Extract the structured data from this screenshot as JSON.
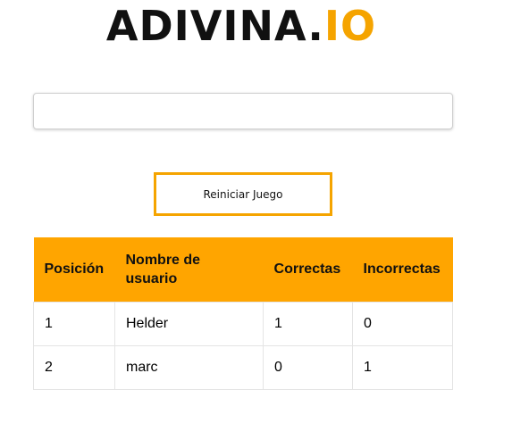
{
  "logo": {
    "main": "ADIVINA.",
    "accent": "IO"
  },
  "input": {
    "value": "",
    "placeholder": ""
  },
  "reset_button": {
    "label": "Reiniciar Juego"
  },
  "table": {
    "headers": [
      "Posición",
      "Nombre de usuario",
      "Correctas",
      "Incorrectas"
    ],
    "rows": [
      [
        "1",
        "Helder",
        "1",
        "0"
      ],
      [
        "2",
        "marc",
        "0",
        "1"
      ]
    ]
  },
  "colors": {
    "accent": "#ffa500",
    "logo_accent": "#f5a400",
    "logo_main": "#111111"
  }
}
